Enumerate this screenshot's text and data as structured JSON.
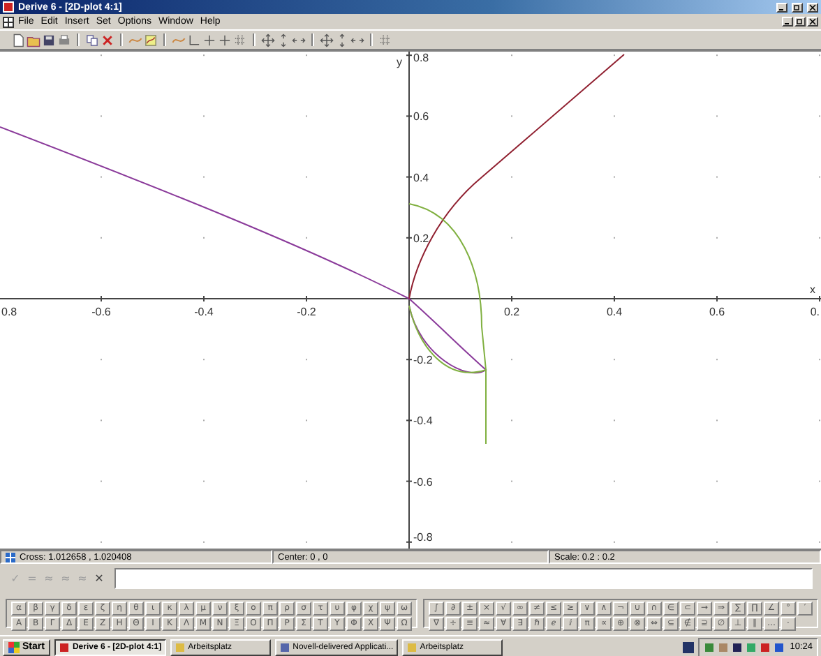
{
  "window": {
    "title": "Derive 6 - [2D-plot 4:1]"
  },
  "menu": [
    {
      "label": "File"
    },
    {
      "label": "Edit"
    },
    {
      "label": "Insert"
    },
    {
      "label": "Set"
    },
    {
      "label": "Options"
    },
    {
      "label": "Window"
    },
    {
      "label": "Help"
    }
  ],
  "plot": {
    "x_axis_name": "x",
    "y_axis_name": "y",
    "x_ticks": [
      {
        "label": "0.8"
      },
      {
        "label": "-0.6"
      },
      {
        "label": "-0.4"
      },
      {
        "label": "-0.2"
      },
      {
        "label": "0.2"
      },
      {
        "label": "0.4"
      },
      {
        "label": "0.6"
      },
      {
        "label": "0."
      }
    ],
    "y_ticks": [
      {
        "label": "0.8"
      },
      {
        "label": "0.6"
      },
      {
        "label": "0.4"
      },
      {
        "label": "0.2"
      },
      {
        "label": "-0.2"
      },
      {
        "label": "-0.4"
      },
      {
        "label": "-0.6"
      },
      {
        "label": "-0.8"
      }
    ]
  },
  "status_bar": {
    "cross": "Cross: 1.012658 , 1.020408",
    "center": "Center: 0 , 0",
    "scale": "Scale: 0.2 : 0.2"
  },
  "entry_buttons": [
    {
      "label": "✓",
      "disabled": true
    },
    {
      "label": "=",
      "disabled": true
    },
    {
      "label": "≈",
      "disabled": true
    },
    {
      "label": "≈",
      "disabled": true
    },
    {
      "label": "≈",
      "disabled": true
    },
    {
      "label": "✕",
      "disabled": false
    }
  ],
  "greek_keys": [
    [
      "α",
      "β",
      "γ",
      "δ",
      "ε",
      "ζ",
      "η",
      "θ",
      "ι",
      "κ",
      "λ",
      "μ",
      "ν",
      "ξ",
      "ο",
      "π",
      "ρ",
      "σ",
      "τ",
      "υ",
      "φ",
      "χ",
      "ψ",
      "ω"
    ],
    [
      "Α",
      "Β",
      "Γ",
      "Δ",
      "Ε",
      "Ζ",
      "Η",
      "Θ",
      "Ι",
      "Κ",
      "Λ",
      "Μ",
      "Ν",
      "Ξ",
      "Ο",
      "Π",
      "Ρ",
      "Σ",
      "Τ",
      "Υ",
      "Φ",
      "Χ",
      "Ψ",
      "Ω"
    ]
  ],
  "math_keys": [
    [
      "∫",
      "∂",
      "±",
      "×",
      "√",
      "∞",
      "≠",
      "≤",
      "≥",
      "∨",
      "∧",
      "¬",
      "∪",
      "∩",
      "∈",
      "⊂",
      "→",
      "⇒",
      "∑",
      "∏",
      "∠",
      "°",
      "′"
    ],
    [
      "∇",
      "÷",
      "≡",
      "≈",
      "∀",
      "∃",
      "ℏ",
      "ℯ",
      "ⅈ",
      "π",
      "∝",
      "⊕",
      "⊗",
      "⇔",
      "⊆",
      "∉",
      "⊇",
      "∅",
      "⊥",
      "∥",
      "…",
      "⋅"
    ]
  ],
  "taskbar": {
    "start": "Start",
    "tasks": [
      {
        "label": "Derive 6 - [2D-plot 4:1]",
        "selected": true
      },
      {
        "label": "Arbeitsplatz",
        "selected": false
      },
      {
        "label": "Novell-delivered Applicati...",
        "selected": false
      },
      {
        "label": "Arbeitsplatz",
        "selected": false
      }
    ],
    "clock": "10:24"
  }
}
